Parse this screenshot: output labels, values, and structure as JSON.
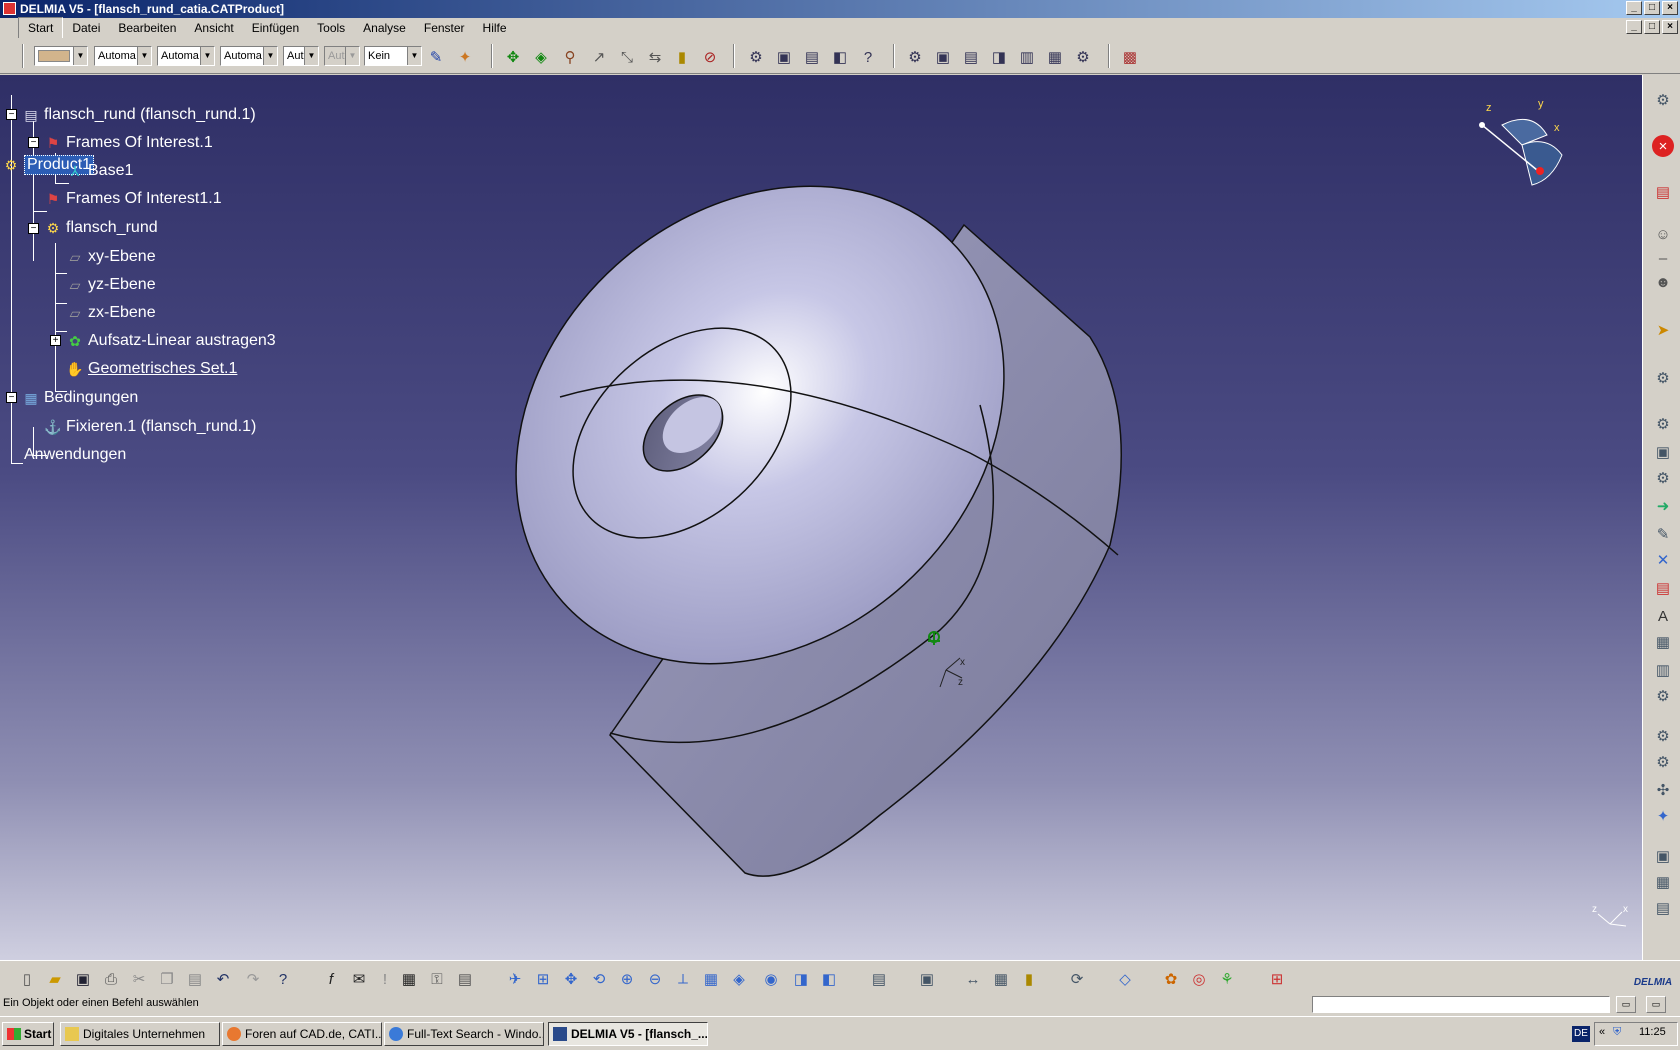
{
  "window": {
    "title": "DELMIA V5 - [flansch_rund_catia.CATProduct]",
    "controls": [
      "_",
      "□",
      "×"
    ],
    "inner_controls": [
      "_",
      "□",
      "×"
    ]
  },
  "menu": [
    "Start",
    "Datei",
    "Bearbeiten",
    "Ansicht",
    "Einfügen",
    "Tools",
    "Analyse",
    "Fenster",
    "Hilfe"
  ],
  "toolbar_top": {
    "color_combo": "",
    "linetype_combo": "Automa",
    "thickness_combo": "Automa",
    "point_combo": "Automa",
    "layer_combo": "Aut",
    "layer2_combo": "Aut",
    "filter_combo": "Kein"
  },
  "tree": {
    "root": "Product1",
    "part": "flansch_rund (flansch_rund.1)",
    "foi1": "Frames Of Interest.1",
    "base": "Base1",
    "foi2": "Frames Of Interest1.1",
    "body": "flansch_rund",
    "xy": "xy-Ebene",
    "yz": "yz-Ebene",
    "zx": "zx-Ebene",
    "pad": "Aufsatz-Linear austragen3",
    "geoset": "Geometrisches Set.1",
    "constraints": "Bedingungen",
    "fix": "Fixieren.1 (flansch_rund.1)",
    "apps": "Anwendungen"
  },
  "compass": {
    "x": "x",
    "y": "y",
    "z": "z"
  },
  "axis_small": {
    "x": "x",
    "z": "z"
  },
  "logo": "DELMIA",
  "status": {
    "message": "Ein Objekt oder einen Befehl auswählen"
  },
  "taskbar": {
    "start": "Start",
    "tasks": [
      "Digitales Unternehmen",
      "Foren auf CAD.de, CATI...",
      "Full-Text Search - Windo...",
      "DELMIA V5 - [flansch_..."
    ],
    "lang": "DE",
    "tray_arrows": "«",
    "clock": "11:25"
  },
  "colors": {
    "title_gradient_start": "#0a246a",
    "viewport_top": "#2f2f66",
    "viewport_bottom": "#cfcfe0",
    "part_surface": "#b8b8d8"
  }
}
